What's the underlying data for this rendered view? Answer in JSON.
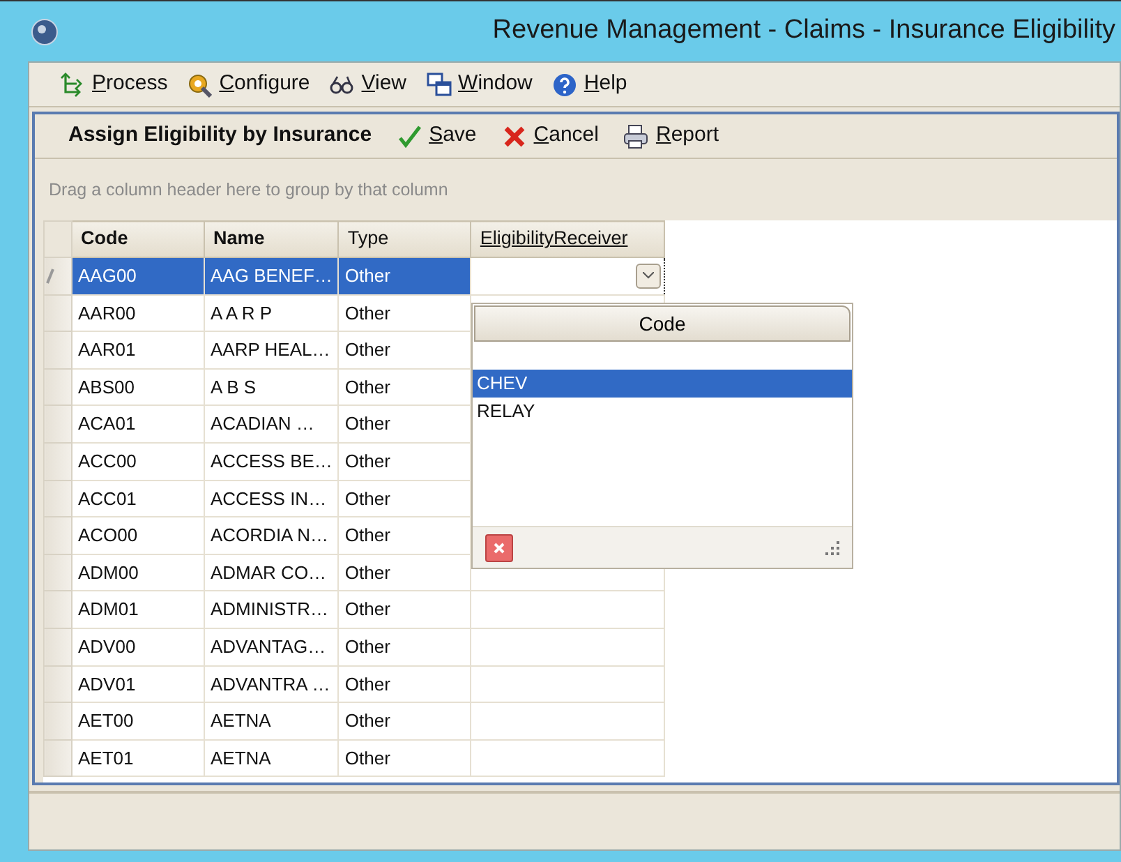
{
  "window": {
    "title": "Revenue Management - Claims - Insurance Eligibility"
  },
  "menu": [
    {
      "label": "Process"
    },
    {
      "label": "Configure"
    },
    {
      "label": "View"
    },
    {
      "label": "Window"
    },
    {
      "label": "Help"
    }
  ],
  "toolbar": {
    "title": "Assign Eligibility by Insurance",
    "buttons": [
      {
        "label": "Save"
      },
      {
        "label": "Cancel"
      },
      {
        "label": "Report"
      }
    ]
  },
  "group_hint": "Drag a column header here to group by that column",
  "grid": {
    "columns": [
      {
        "label": "Code",
        "bold": true
      },
      {
        "label": "Name",
        "bold": true
      },
      {
        "label": "Type",
        "bold": false
      },
      {
        "label": "EligibilityReceiver",
        "bold": false
      }
    ],
    "rows": [
      {
        "code": "AAG00",
        "name": "AAG BENEF…",
        "type": "Other",
        "selected": true
      },
      {
        "code": "AAR00",
        "name": "A A R P",
        "type": "Other",
        "selected": false
      },
      {
        "code": "AAR01",
        "name": "AARP HEAL…",
        "type": "Other",
        "selected": false
      },
      {
        "code": "ABS00",
        "name": "A B S",
        "type": "Other",
        "selected": false
      },
      {
        "code": "ACA01",
        "name": "ACADIAN  …",
        "type": "Other",
        "selected": false
      },
      {
        "code": "ACC00",
        "name": "ACCESS BE…",
        "type": "Other",
        "selected": false
      },
      {
        "code": "ACC01",
        "name": "ACCESS IN…",
        "type": "Other",
        "selected": false
      },
      {
        "code": "ACO00",
        "name": "ACORDIA N…",
        "type": "Other",
        "selected": false
      },
      {
        "code": "ADM00",
        "name": "ADMAR CO…",
        "type": "Other",
        "selected": false
      },
      {
        "code": "ADM01",
        "name": "ADMINISTR…",
        "type": "Other",
        "selected": false
      },
      {
        "code": "ADV00",
        "name": "ADVANTAG…",
        "type": "Other",
        "selected": false
      },
      {
        "code": "ADV01",
        "name": "ADVANTRA …",
        "type": "Other",
        "selected": false
      },
      {
        "code": "AET00",
        "name": "AETNA",
        "type": "Other",
        "selected": false
      },
      {
        "code": "AET01",
        "name": "AETNA",
        "type": "Other",
        "selected": false
      }
    ]
  },
  "dropdown": {
    "header": "Code",
    "options": [
      {
        "label": "CHEV",
        "selected": true
      },
      {
        "label": "RELAY",
        "selected": false
      }
    ]
  }
}
